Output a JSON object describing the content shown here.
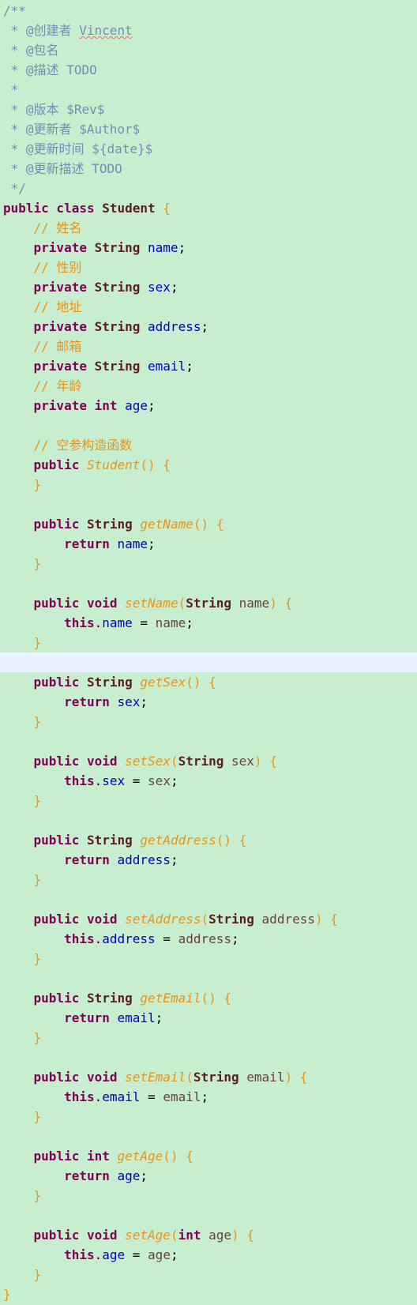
{
  "editor": {
    "language": "Java",
    "current_line_index": 33,
    "lines": [
      [
        [
          "/**",
          "javadoc"
        ]
      ],
      [
        [
          " * ",
          "javadoc"
        ],
        [
          "@创建者 ",
          "javadoc"
        ],
        [
          "Vincent",
          "javadoc u"
        ]
      ],
      [
        [
          " * ",
          "javadoc"
        ],
        [
          "@包名",
          "javadoc"
        ]
      ],
      [
        [
          " * ",
          "javadoc"
        ],
        [
          "@描述 ",
          "javadoc"
        ],
        [
          "TODO",
          "javadoc"
        ]
      ],
      [
        [
          " *",
          "javadoc"
        ]
      ],
      [
        [
          " * ",
          "javadoc"
        ],
        [
          "@版本 ",
          "javadoc"
        ],
        [
          "$Rev$",
          "javadoc"
        ]
      ],
      [
        [
          " * ",
          "javadoc"
        ],
        [
          "@更新者 ",
          "javadoc"
        ],
        [
          "$Author$",
          "javadoc"
        ]
      ],
      [
        [
          " * ",
          "javadoc"
        ],
        [
          "@更新时间 ",
          "javadoc"
        ],
        [
          "${date}$",
          "javadoc"
        ]
      ],
      [
        [
          " * ",
          "javadoc"
        ],
        [
          "@更新描述 ",
          "javadoc"
        ],
        [
          "TODO",
          "javadoc"
        ]
      ],
      [
        [
          " */",
          "javadoc"
        ]
      ],
      [
        [
          "public class ",
          "keyword"
        ],
        [
          "Student ",
          "type"
        ],
        [
          "{",
          "brace"
        ]
      ],
      [
        [
          "    // 姓名",
          "comment"
        ]
      ],
      [
        [
          "    ",
          "plain"
        ],
        [
          "private ",
          "keyword"
        ],
        [
          "String ",
          "type"
        ],
        [
          "name",
          "field"
        ],
        [
          ";",
          "punct"
        ]
      ],
      [
        [
          "    // 性别",
          "comment"
        ]
      ],
      [
        [
          "    ",
          "plain"
        ],
        [
          "private ",
          "keyword"
        ],
        [
          "String ",
          "type"
        ],
        [
          "sex",
          "field"
        ],
        [
          ";",
          "punct"
        ]
      ],
      [
        [
          "    // 地址",
          "comment"
        ]
      ],
      [
        [
          "    ",
          "plain"
        ],
        [
          "private ",
          "keyword"
        ],
        [
          "String ",
          "type"
        ],
        [
          "address",
          "field"
        ],
        [
          ";",
          "punct"
        ]
      ],
      [
        [
          "    // 邮箱",
          "comment"
        ]
      ],
      [
        [
          "    ",
          "plain"
        ],
        [
          "private ",
          "keyword"
        ],
        [
          "String ",
          "type"
        ],
        [
          "email",
          "field"
        ],
        [
          ";",
          "punct"
        ]
      ],
      [
        [
          "    // 年龄",
          "comment"
        ]
      ],
      [
        [
          "    ",
          "plain"
        ],
        [
          "private ",
          "keyword"
        ],
        [
          "int ",
          "keyword"
        ],
        [
          "age",
          "field"
        ],
        [
          ";",
          "punct"
        ]
      ],
      [],
      [
        [
          "    // 空参构造函数",
          "comment"
        ]
      ],
      [
        [
          "    ",
          "plain"
        ],
        [
          "public ",
          "keyword"
        ],
        [
          "Student",
          "method"
        ],
        [
          "() {",
          "brace"
        ]
      ],
      [
        [
          "    }",
          "brace"
        ]
      ],
      [],
      [
        [
          "    ",
          "plain"
        ],
        [
          "public ",
          "keyword"
        ],
        [
          "String ",
          "type"
        ],
        [
          "getName",
          "method"
        ],
        [
          "() {",
          "brace"
        ]
      ],
      [
        [
          "        ",
          "plain"
        ],
        [
          "return ",
          "keyword"
        ],
        [
          "name",
          "field"
        ],
        [
          ";",
          "punct"
        ]
      ],
      [
        [
          "    }",
          "brace"
        ]
      ],
      [],
      [
        [
          "    ",
          "plain"
        ],
        [
          "public ",
          "keyword"
        ],
        [
          "void ",
          "keyword"
        ],
        [
          "setName",
          "method"
        ],
        [
          "(",
          "brace"
        ],
        [
          "String ",
          "type"
        ],
        [
          "name",
          "param"
        ],
        [
          ") {",
          "brace"
        ]
      ],
      [
        [
          "        ",
          "plain"
        ],
        [
          "this",
          "keyword"
        ],
        [
          ".",
          "punct"
        ],
        [
          "name",
          "field"
        ],
        [
          " = ",
          "punct"
        ],
        [
          "name",
          "param"
        ],
        [
          ";",
          "punct"
        ]
      ],
      [
        [
          "    }",
          "brace"
        ]
      ],
      [],
      [
        [
          "    ",
          "plain"
        ],
        [
          "public ",
          "keyword"
        ],
        [
          "String ",
          "type"
        ],
        [
          "getSex",
          "method"
        ],
        [
          "() {",
          "brace"
        ]
      ],
      [
        [
          "        ",
          "plain"
        ],
        [
          "return ",
          "keyword"
        ],
        [
          "sex",
          "field"
        ],
        [
          ";",
          "punct"
        ]
      ],
      [
        [
          "    }",
          "brace"
        ]
      ],
      [],
      [
        [
          "    ",
          "plain"
        ],
        [
          "public ",
          "keyword"
        ],
        [
          "void ",
          "keyword"
        ],
        [
          "setSex",
          "method"
        ],
        [
          "(",
          "brace"
        ],
        [
          "String ",
          "type"
        ],
        [
          "sex",
          "param"
        ],
        [
          ") {",
          "brace"
        ]
      ],
      [
        [
          "        ",
          "plain"
        ],
        [
          "this",
          "keyword"
        ],
        [
          ".",
          "punct"
        ],
        [
          "sex",
          "field"
        ],
        [
          " = ",
          "punct"
        ],
        [
          "sex",
          "param"
        ],
        [
          ";",
          "punct"
        ]
      ],
      [
        [
          "    }",
          "brace"
        ]
      ],
      [],
      [
        [
          "    ",
          "plain"
        ],
        [
          "public ",
          "keyword"
        ],
        [
          "String ",
          "type"
        ],
        [
          "getAddress",
          "method"
        ],
        [
          "() {",
          "brace"
        ]
      ],
      [
        [
          "        ",
          "plain"
        ],
        [
          "return ",
          "keyword"
        ],
        [
          "address",
          "field"
        ],
        [
          ";",
          "punct"
        ]
      ],
      [
        [
          "    }",
          "brace"
        ]
      ],
      [],
      [
        [
          "    ",
          "plain"
        ],
        [
          "public ",
          "keyword"
        ],
        [
          "void ",
          "keyword"
        ],
        [
          "setAddress",
          "method"
        ],
        [
          "(",
          "brace"
        ],
        [
          "String ",
          "type"
        ],
        [
          "address",
          "param"
        ],
        [
          ") {",
          "brace"
        ]
      ],
      [
        [
          "        ",
          "plain"
        ],
        [
          "this",
          "keyword"
        ],
        [
          ".",
          "punct"
        ],
        [
          "address",
          "field"
        ],
        [
          " = ",
          "punct"
        ],
        [
          "address",
          "param"
        ],
        [
          ";",
          "punct"
        ]
      ],
      [
        [
          "    }",
          "brace"
        ]
      ],
      [],
      [
        [
          "    ",
          "plain"
        ],
        [
          "public ",
          "keyword"
        ],
        [
          "String ",
          "type"
        ],
        [
          "getEmail",
          "method"
        ],
        [
          "() {",
          "brace"
        ]
      ],
      [
        [
          "        ",
          "plain"
        ],
        [
          "return ",
          "keyword"
        ],
        [
          "email",
          "field"
        ],
        [
          ";",
          "punct"
        ]
      ],
      [
        [
          "    }",
          "brace"
        ]
      ],
      [],
      [
        [
          "    ",
          "plain"
        ],
        [
          "public ",
          "keyword"
        ],
        [
          "void ",
          "keyword"
        ],
        [
          "setEmail",
          "method"
        ],
        [
          "(",
          "brace"
        ],
        [
          "String ",
          "type"
        ],
        [
          "email",
          "param"
        ],
        [
          ") {",
          "brace"
        ]
      ],
      [
        [
          "        ",
          "plain"
        ],
        [
          "this",
          "keyword"
        ],
        [
          ".",
          "punct"
        ],
        [
          "email",
          "field"
        ],
        [
          " = ",
          "punct"
        ],
        [
          "email",
          "param"
        ],
        [
          ";",
          "punct"
        ]
      ],
      [
        [
          "    }",
          "brace"
        ]
      ],
      [],
      [
        [
          "    ",
          "plain"
        ],
        [
          "public ",
          "keyword"
        ],
        [
          "int ",
          "keyword"
        ],
        [
          "getAge",
          "method"
        ],
        [
          "() {",
          "brace"
        ]
      ],
      [
        [
          "        ",
          "plain"
        ],
        [
          "return ",
          "keyword"
        ],
        [
          "age",
          "field"
        ],
        [
          ";",
          "punct"
        ]
      ],
      [
        [
          "    }",
          "brace"
        ]
      ],
      [],
      [
        [
          "    ",
          "plain"
        ],
        [
          "public ",
          "keyword"
        ],
        [
          "void ",
          "keyword"
        ],
        [
          "setAge",
          "method"
        ],
        [
          "(",
          "brace"
        ],
        [
          "int ",
          "keyword"
        ],
        [
          "age",
          "param"
        ],
        [
          ") {",
          "brace"
        ]
      ],
      [
        [
          "        ",
          "plain"
        ],
        [
          "this",
          "keyword"
        ],
        [
          ".",
          "punct"
        ],
        [
          "age",
          "field"
        ],
        [
          " = ",
          "punct"
        ],
        [
          "age",
          "param"
        ],
        [
          ";",
          "punct"
        ]
      ],
      [
        [
          "    }",
          "brace"
        ]
      ],
      [
        [
          "}",
          "brace"
        ]
      ]
    ],
    "colors": {
      "background": "#c7eecf",
      "current_line": "#e8f2fe",
      "keyword": "#7f0055",
      "type": "#5a1e1e",
      "field": "#0000c0",
      "method": "#e8941a",
      "comment": "#e8941a",
      "javadoc": "#6f8fb7"
    }
  }
}
